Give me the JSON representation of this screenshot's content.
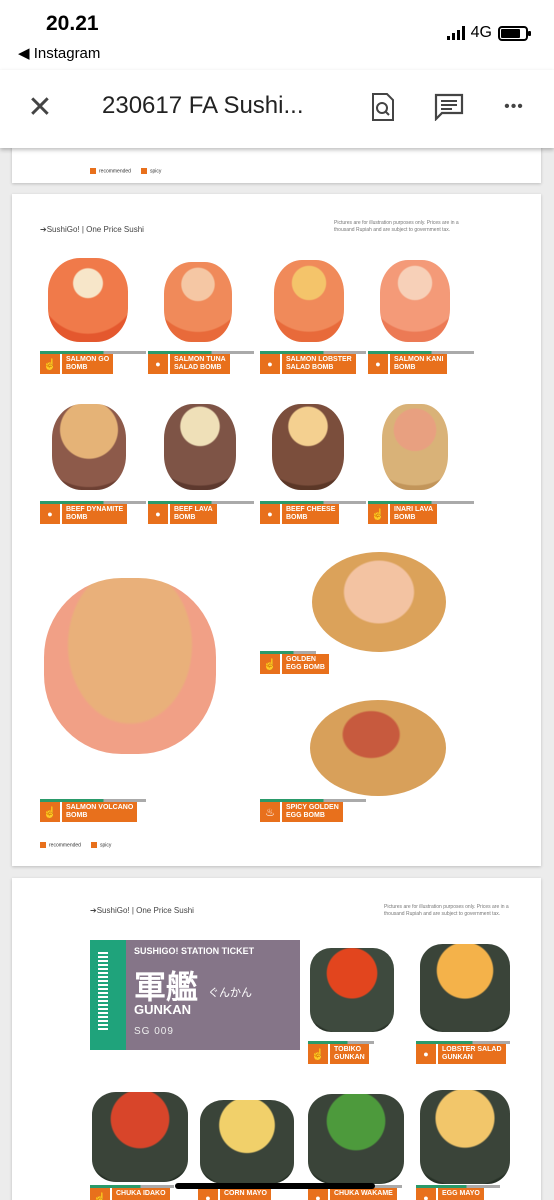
{
  "status": {
    "time": "20.21",
    "back_app": "◀ Instagram",
    "network": "4G"
  },
  "toolbar": {
    "title": "230617  FA Sushi...",
    "close_glyph": "✕",
    "more_glyph": "•••"
  },
  "legend": {
    "recommended": "recommended",
    "spicy": "spicy"
  },
  "page2": {
    "header": "➔SushiGo! | One Price Sushi",
    "note": "Pictures are for illustration purposes only. Prices are in a thousand Rupiah and are subject to government tax.",
    "items": [
      {
        "label": "SALMON GO\nBOMB",
        "icon": "thumb"
      },
      {
        "label": "SALMON TUNA\nSALAD BOMB",
        "icon": "dot"
      },
      {
        "label": "SALMON LOBSTER\nSALAD BOMB",
        "icon": "dot"
      },
      {
        "label": "SALMON KANI\nBOMB",
        "icon": "dot"
      },
      {
        "label": "BEEF DYNAMITE\nBOMB",
        "icon": "dot"
      },
      {
        "label": "BEEF LAVA\nBOMB",
        "icon": "dot"
      },
      {
        "label": "BEEF CHEESE\nBOMB",
        "icon": "dot"
      },
      {
        "label": "INARI LAVA\nBOMB",
        "icon": "thumb"
      },
      {
        "label": "GOLDEN\nEGG BOMB",
        "icon": "thumb"
      },
      {
        "label": "SALMON VOLCANO\nBOMB",
        "icon": "thumb"
      },
      {
        "label": "SPICY GOLDEN\nEGG BOMB",
        "icon": "fire"
      }
    ]
  },
  "page3": {
    "header": "➔SushiGo! | One Price Sushi",
    "note": "Pictures are for illustration purposes only. Prices are in a thousand Rupiah and are subject to government tax.",
    "ticket": {
      "title": "SUSHIGO! STATION TICKET",
      "kanji": "軍艦",
      "kana": "ぐんかん",
      "name": "GUNKAN",
      "code": "SG 009"
    },
    "items": [
      {
        "label": "TOBIKO\nGUNKAN",
        "icon": "thumb"
      },
      {
        "label": "LOBSTER SALAD\nGUNKAN",
        "icon": "dot"
      },
      {
        "label": "CHUKA IDAKO",
        "icon": "thumb"
      },
      {
        "label": "CORN MAYO",
        "icon": "dot"
      },
      {
        "label": "CHUKA WAKAME",
        "icon": "dot"
      },
      {
        "label": "EGG MAYO",
        "icon": "dot"
      }
    ]
  },
  "colors": {
    "accent": "#e8701c",
    "green": "#2a9a6a",
    "ticket": "#857588"
  }
}
